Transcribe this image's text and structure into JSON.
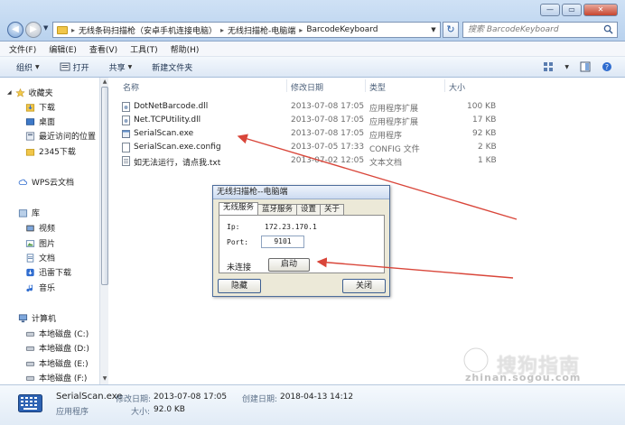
{
  "window": {
    "buttons": [
      "—",
      "▭",
      "✕"
    ]
  },
  "address": {
    "crumbs": [
      "无线条码扫描枪（安卓手机连接电脑）",
      "无线扫描枪-电脑端",
      "BarcodeKeyboard"
    ],
    "search_placeholder": "搜索 BarcodeKeyboard"
  },
  "menu": [
    "文件(F)",
    "编辑(E)",
    "查看(V)",
    "工具(T)",
    "帮助(H)"
  ],
  "toolbar": {
    "organize": "组织",
    "open": "打开",
    "share": "共享",
    "new_folder": "新建文件夹"
  },
  "nav": {
    "favorites": "收藏夹",
    "downloads": "下载",
    "desktop": "桌面",
    "recent": "最近访问的位置",
    "download2345": "2345下载",
    "wps": "WPS云文档",
    "library": "库",
    "videos": "视频",
    "pictures": "图片",
    "documents": "文档",
    "thunder": "迅雷下载",
    "music": "音乐",
    "computer": "计算机",
    "drive_c": "本地磁盘 (C:)",
    "drive_d": "本地磁盘 (D:)",
    "drive_e": "本地磁盘 (E:)",
    "drive_f": "本地磁盘 (F:)"
  },
  "columns": {
    "name": "名称",
    "modified": "修改日期",
    "type": "类型",
    "size": "大小"
  },
  "files": [
    {
      "name": "DotNetBarcode.dll",
      "modified": "2013-07-08 17:05",
      "type": "应用程序扩展",
      "size": "100 KB"
    },
    {
      "name": "Net.TCPUtility.dll",
      "modified": "2013-07-08 17:05",
      "type": "应用程序扩展",
      "size": "17 KB"
    },
    {
      "name": "SerialScan.exe",
      "modified": "2013-07-08 17:05",
      "type": "应用程序",
      "size": "92 KB"
    },
    {
      "name": "SerialScan.exe.config",
      "modified": "2013-07-05 17:33",
      "type": "CONFIG 文件",
      "size": "2 KB"
    },
    {
      "name": "如无法运行，请点我.txt",
      "modified": "2013-07-02 12:05",
      "type": "文本文档",
      "size": "1 KB"
    }
  ],
  "dialog": {
    "title": "无线扫描枪--电脑端",
    "tabs": [
      "无线服务",
      "蓝牙服务",
      "设置",
      "关于"
    ],
    "ip_label": "Ip:",
    "ip_value": "172.23.170.1",
    "port_label": "Port:",
    "port_value": "9101",
    "status": "未连接",
    "start": "启动",
    "hide": "隐藏",
    "close": "关闭"
  },
  "details": {
    "name": "SerialScan.exe",
    "modified_label": "修改日期:",
    "modified_value": "2013-07-08 17:05",
    "created_label": "创建日期:",
    "created_value": "2018-04-13 14:12",
    "type": "应用程序",
    "size_label": "大小:",
    "size_value": "92.0 KB"
  },
  "watermark": {
    "brand": "搜狗指南",
    "url": "zhinan.sogou.com"
  },
  "colors": {
    "annotation_arrow": "#d9463a",
    "selection": "#e5f1fb"
  }
}
